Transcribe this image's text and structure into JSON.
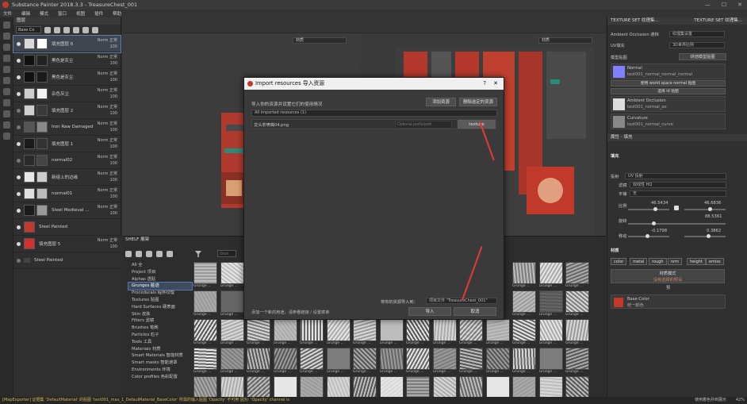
{
  "window": {
    "title": "Substance Painter 2018.3.3 - TreasureChest_001",
    "controls": [
      "—",
      "☐",
      "✕"
    ]
  },
  "menu": [
    "文件",
    "编辑",
    "模式",
    "窗口",
    "视图",
    "插件",
    "帮助"
  ],
  "layers_panel": {
    "title": "图层",
    "blend_mode": "Base Co",
    "layers": [
      {
        "name": "填充图层 6",
        "blend": "Norm",
        "opacity_label": "正常",
        "opacity": "100",
        "thumb": "#d9d9d9",
        "mask": "#ffffff",
        "visible": true,
        "selected": true
      },
      {
        "name": "黑色是灰尘",
        "blend": "Norm",
        "opacity_label": "正常",
        "opacity": "100",
        "thumb": "#111111",
        "mask": "#222222",
        "visible": true
      },
      {
        "name": "黑色是灰尘",
        "blend": "Norm",
        "opacity_label": "正常",
        "opacity": "100",
        "thumb": "#111111",
        "mask": "#1a1a1a",
        "visible": true
      },
      {
        "name": "杂色灰尘",
        "blend": "Norm",
        "opacity_label": "正常",
        "opacity": "100",
        "thumb": "#cfcfcf",
        "mask": "#f2f2f2",
        "visible": true
      },
      {
        "name": "填充图层 2",
        "blend": "Norm",
        "opacity_label": "正常",
        "opacity": "100",
        "thumb": "#d0d0d0",
        "mask": "#3a3a3a",
        "visible": false
      },
      {
        "name": "Iron Raw Damaged",
        "blend": "Norm",
        "opacity_label": "正常",
        "opacity": "100",
        "thumb": "#555555",
        "mask": "#888888",
        "visible": false
      },
      {
        "name": "填充图层 1",
        "blend": "Norm",
        "opacity_label": "正常",
        "opacity": "100",
        "thumb": "#1a1a1a",
        "mask": "#333333",
        "visible": true
      },
      {
        "name": "normal02",
        "blend": "Norm",
        "opacity_label": "正常",
        "opacity": "100",
        "thumb": "#2a2a2a",
        "mask": "#444444",
        "visible": false
      },
      {
        "name": "新组上的边缘",
        "blend": "Norm",
        "opacity_label": "正常",
        "opacity": "100",
        "thumb": "#e8e8e8",
        "mask": "#cccccc",
        "visible": true
      },
      {
        "name": "normal01",
        "blend": "Norm",
        "opacity_label": "正常",
        "opacity": "100",
        "thumb": "#e0e0e0",
        "mask": "#bbbbbb",
        "visible": true
      },
      {
        "name": "Steel Medieval ...",
        "blend": "Norm",
        "opacity_label": "正常",
        "opacity": "100",
        "thumb": "#1b1b1b",
        "mask": "#999999",
        "visible": true
      },
      {
        "name": "Steel Painted",
        "blend": "",
        "opacity_label": "",
        "opacity": "",
        "thumb": "#c0392b",
        "mask": "",
        "visible": true
      },
      {
        "name": "填充图层 5",
        "blend": "Norm",
        "opacity_label": "正常",
        "opacity": "100",
        "thumb": "#d32f2f",
        "mask": "",
        "visible": true
      },
      {
        "name": "Steel Painted",
        "blend": "",
        "opacity_label": "",
        "opacity": "",
        "thumb": "",
        "mask": "",
        "visible": false
      }
    ]
  },
  "viewports": {
    "left_mode": "材质",
    "right_mode": "材质"
  },
  "shelf": {
    "title": "SHELF 展架",
    "search_placeholder": "Grun",
    "categories": [
      {
        "label": "All 全"
      },
      {
        "label": "Project 项目"
      },
      {
        "label": "Alphas 透贴"
      },
      {
        "label": "Grunges 脏迹",
        "selected": true
      },
      {
        "label": "Procedurals 程序纹理"
      },
      {
        "label": "Textures 贴图"
      },
      {
        "label": "Hard Surfaces 硬表面"
      },
      {
        "label": "Skin 皮肤"
      },
      {
        "label": "Filters 滤镜"
      },
      {
        "label": "Brushes 笔刷"
      },
      {
        "label": "Particles 粒子"
      },
      {
        "label": "Tools 工具"
      },
      {
        "label": "Materials 材质"
      },
      {
        "label": "Smart Materials 智能材质"
      },
      {
        "label": "Smart masks 智能遮罩"
      },
      {
        "label": "Environments 环境"
      },
      {
        "label": "Color profiles 色彩配置"
      }
    ],
    "tile_caption": "Grunge ..."
  },
  "texture_set": {
    "title": "TEXTURE SET 纹理集...",
    "title2": "TEXTURE SET 纹理集...",
    "ao_label": "Ambient Occlusion 遮挡",
    "ao_value": "纹理集设置",
    "uv_label": "UV填充",
    "uv_value": "3D世界比例",
    "maps_label": "模型贴图",
    "bake_button": "烘焙模型贴图",
    "maps": [
      {
        "name": "Normal",
        "file": "test001_normal_normal_normal",
        "note": "使用 world space normal 贴图",
        "color": "#7f7fff"
      },
      {
        "name": "",
        "file": "",
        "note": "选择 id 贴图",
        "color": ""
      },
      {
        "name": "Ambient Occlusion",
        "file": "test001_normal_ao",
        "note": "",
        "color": "#dddddd"
      },
      {
        "name": "Curvature",
        "file": "test001_normal_curve",
        "note": "",
        "color": "#888888"
      }
    ]
  },
  "properties": {
    "title": "属性 - 填充",
    "section_fill": "填充",
    "projection_label": "投射",
    "projection_value": "UV 投射",
    "filter_label": "滤镜",
    "filter_value": "双线性 HQ",
    "tiling_label": "平铺",
    "tiling_value": "无",
    "scale_label": "比例",
    "scale_u": "46.5434",
    "scale_v": "46.6836",
    "rotation_label": "旋转",
    "rotation_value": "88.5361",
    "offset_label": "移动",
    "offset_u": "-0.1798",
    "offset_v": "0.3862",
    "section_material": "材质",
    "channels": [
      "color",
      "metal",
      "rough",
      "nrm",
      "height",
      "emiss"
    ],
    "material_mode": "材质模式",
    "material_mode_value": "没有选择的预设",
    "material_mode_sub": "预",
    "base_color_label": "Base Color",
    "base_color_value": "统一颜色",
    "base_color_hex": "#c0392b"
  },
  "dialog": {
    "title": "Import resources 导入资源",
    "help": "?",
    "close": "✕",
    "instruction": "导入你的资源并设置它们的使用情况",
    "add_button": "添加资源",
    "remove_button": "删除选定的资源",
    "filter": "All imported resources (1)",
    "resource_name": "龙头茶喷嘴04.png",
    "prefix_placeholder": "Optional prefix/path",
    "type_value": "texture",
    "hint": "添加一个新的用途，请参看链接 / 设置菜单",
    "import_to_label": "将你的资源导入到：",
    "import_to_value": "项目文件 \"TreasureChest_001\"",
    "import_button": "导入",
    "cancel_button": "取消"
  },
  "status": {
    "message": "[MapExporter] 证据集 'DefaultMaterial' 的贴图 'test001_max_1_DefaulMaterial_BaseColor' 所需的输入贴图 'Opacity' 不可用 因为: 'Opacity' channel is ",
    "right": "使用着色并到展示",
    "zoom": "42%"
  },
  "colors": {
    "accent": "#5577aa",
    "arrow": "#e53935",
    "brand": "#c0392b"
  }
}
